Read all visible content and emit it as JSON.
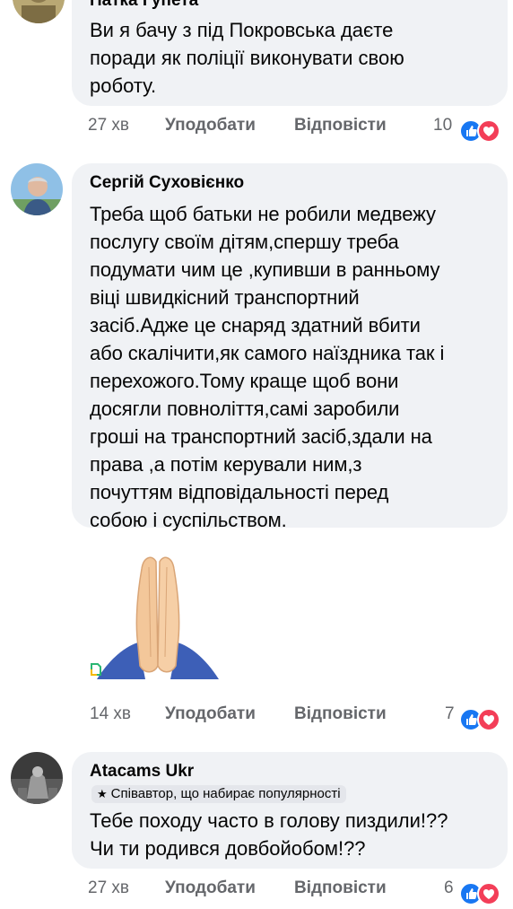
{
  "comments": [
    {
      "author": "Патка Гупета",
      "text": "Ви я бачу з під Покровська даєте\nпоради як поліції виконувати свою\nроботу.",
      "time": "27 хв",
      "like_label": "Уподобати",
      "reply_label": "Відповісти",
      "reaction_count": "10"
    },
    {
      "author": "Сергій Суховієнко",
      "text": "Треба щоб батьки не робили медвежу\nпослугу своїм дітям,спершу треба\nподумати чим це ,купивши в ранньому\nвіці швидкісний транспортний\nзасіб.Адже це снаряд здатний вбити\nабо скалічити,як самого наїздника так і\nперехожого.Тому краще щоб вони\nдосягли повноліття,самі заробили\nгроші на транспортний засіб,здали на\nправа ,а потім керували ним,з\nпочуттям відповідальності перед\nсобою і суспільством.",
      "sticker": "praying-hands-emoji",
      "time": "14 хв",
      "like_label": "Уподобати",
      "reply_label": "Відповісти",
      "reaction_count": "7"
    },
    {
      "author": "Atacams Ukr",
      "badge": "Співавтор, що набирає популярності",
      "text": "Тебе походу часто в голову пиздили!??\nЧи ти родився довбойобом!??",
      "time": "27 хв",
      "like_label": "Уподобати",
      "reply_label": "Відповісти",
      "reaction_count": "6"
    }
  ],
  "colors": {
    "bubble": "#f0f2f5",
    "meta_text": "#65676b",
    "like_blue": "#1877f2",
    "love_red": "#f33e58"
  }
}
